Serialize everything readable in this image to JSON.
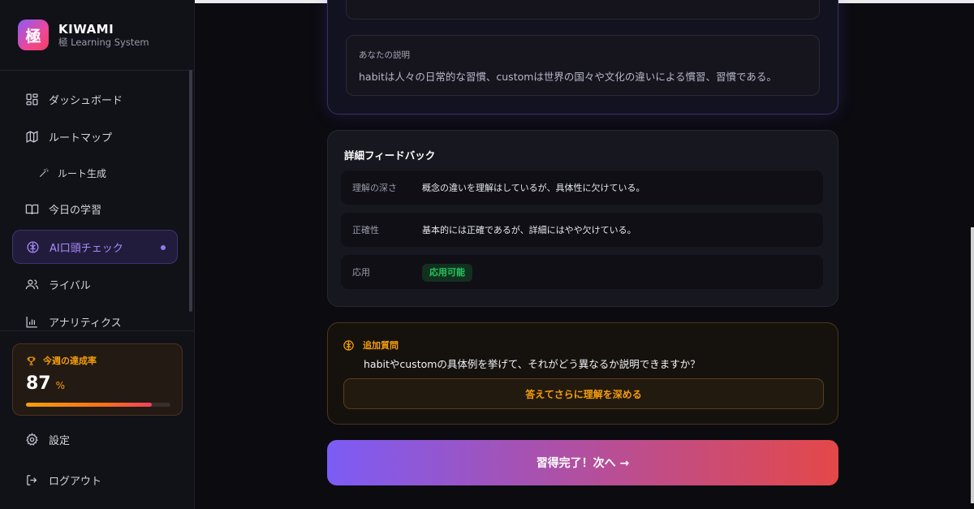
{
  "brand": {
    "logo_char": "極",
    "name": "KIWAMI",
    "subtitle": "極 Learning System"
  },
  "nav": [
    {
      "label": "ダッシュボード",
      "icon": "dashboard-icon"
    },
    {
      "label": "ルートマップ",
      "icon": "map-icon"
    },
    {
      "label": "ルート生成",
      "icon": "magic-wand-icon"
    },
    {
      "label": "今日の学習",
      "icon": "book-icon"
    },
    {
      "label": "AI口頭チェック",
      "icon": "brain-icon",
      "active": true
    },
    {
      "label": "ライバル",
      "icon": "users-icon"
    },
    {
      "label": "アナリティクス",
      "icon": "bar-chart-icon"
    }
  ],
  "weekly": {
    "title": "今週の達成率",
    "value": "87",
    "unit": "%",
    "progress": 0.87
  },
  "bottom_nav": {
    "settings": "設定",
    "logout": "ログアウト"
  },
  "explanation": {
    "label": "あなたの説明",
    "text": "habitは人々の日常的な習慣、customは世界の国々や文化の違いによる慣習、習慣である。"
  },
  "feedback": {
    "title": "詳細フィードバック",
    "rows": [
      {
        "key": "理解の深さ",
        "value": "概念の違いを理解はしているが、具体性に欠けている。"
      },
      {
        "key": "正確性",
        "value": "基本的には正確であるが、詳細にはやや欠けている。"
      },
      {
        "key": "応用",
        "value": "応用可能"
      }
    ]
  },
  "followup": {
    "title": "追加質問",
    "question": "habitやcustomの具体例を挙げて、それがどう異なるか説明できますか？",
    "button": "答えてさらに理解を深める"
  },
  "complete_button": "習得完了！次へ →",
  "colors": {
    "accent_purple": "#8b5cf6",
    "accent_orange": "#f59e0b",
    "success_green": "#22c55e"
  }
}
